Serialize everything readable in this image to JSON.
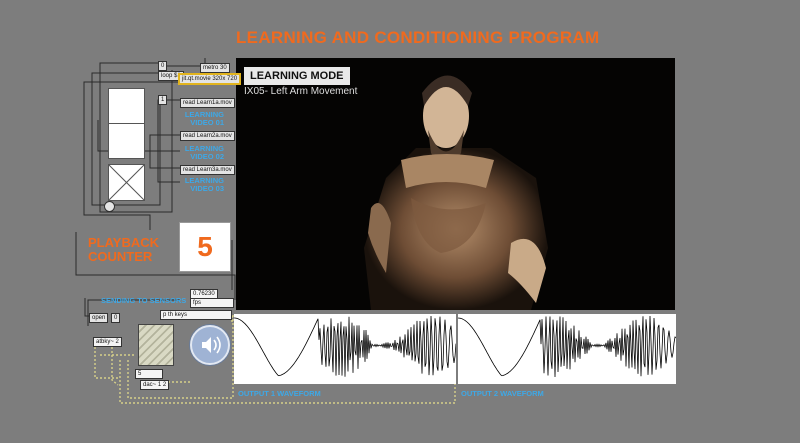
{
  "title": "LEARNING AND CONDITIONING PROGRAM",
  "video": {
    "mode_badge": "LEARNING MODE",
    "subtitle": "IX05- Left Arm Movement"
  },
  "patch": {
    "msg_zero": "0",
    "msg_loop": "loop $1",
    "msg_metro": "metro 30",
    "msg_jit": "jit.qt.movie 320x 720",
    "msg_one": "1",
    "read1": "read Learn1a.mov",
    "read2": "read Learn2a.mov",
    "read3": "read Learn3a.mov",
    "float_value": "0.76230",
    "msg_fps": "fps",
    "msg_keys": "p th keys",
    "msg_open": "open",
    "msg_zero2": "0",
    "msg_abs": "atbky~ 2",
    "num_5": "5",
    "msg_dac": "dac~ 1 2"
  },
  "learning_videos": [
    {
      "line1": "LEARNING",
      "line2": "VIDEO 01"
    },
    {
      "line1": "LEARNING",
      "line2": "VIDEO 02"
    },
    {
      "line1": "LEARNING",
      "line2": "VIDEO 03"
    }
  ],
  "counter": {
    "line1": "PLAYBACK",
    "line2": "COUNTER",
    "value": "5"
  },
  "sensors_label": "SENDING TO SENSORS",
  "waveforms": {
    "output1_label": "OUTPUT 1 WAVEFORM",
    "output2_label": "OUTPUT 2 WAVEFORM"
  },
  "icons": {
    "speaker": "speaker-icon",
    "toggle": "toggle-icon"
  },
  "colors": {
    "title": "#f06a1e",
    "label_blue": "#3ea8e6",
    "patch_cord": "#d6d08a"
  }
}
